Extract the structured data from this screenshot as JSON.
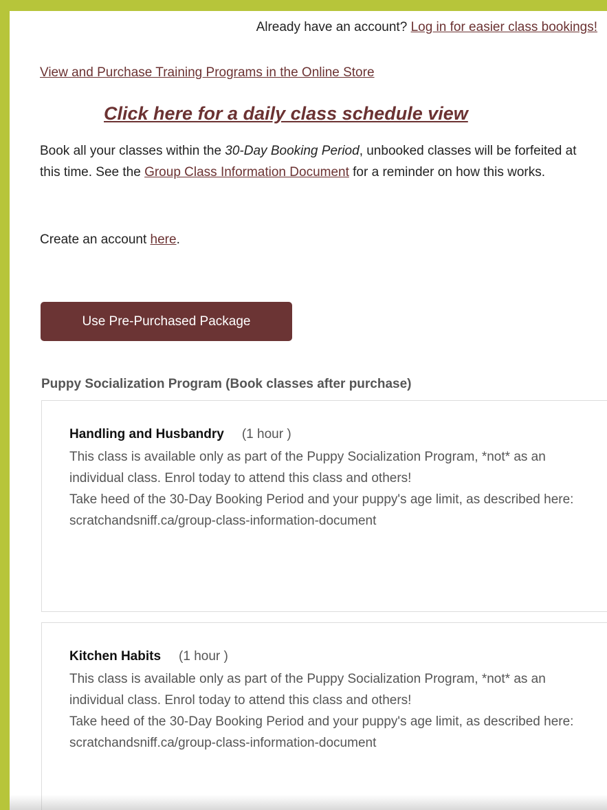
{
  "header": {
    "account_prompt": "Already have an account?",
    "login_link": "Log in for easier class bookings!"
  },
  "store_link": "View and Purchase Training Programs in the Online Store",
  "schedule_link": "Click here for a daily class schedule view",
  "intro": {
    "part1": "Book all your classes within the ",
    "booking_period": "30-Day Booking Period",
    "part2": ", unbooked classes will be forfeited at this time. See the ",
    "info_link": "Group Class Information Document",
    "part3": " for a reminder on how this works."
  },
  "create_account": {
    "prefix": "Create an account ",
    "link": "here",
    "suffix": "."
  },
  "package_button": "Use Pre-Purchased Package",
  "program": {
    "heading": "Puppy Socialization Program (Book classes after purchase)",
    "classes": [
      {
        "name": "Handling and Husbandry",
        "duration": "(1 hour )",
        "description": "This class is available only as part of the Puppy Socialization Program, *not* as an individual class. Enrol today to attend this class and others!",
        "note": "Take heed of the 30-Day Booking Period and your puppy's age limit, as described here: scratchandsniff.ca/group-class-information-document"
      },
      {
        "name": "Kitchen Habits",
        "duration": "(1 hour )",
        "description": "This class is available only as part of the Puppy Socialization Program, *not* as an individual class. Enrol today to attend this class and others!",
        "note": "Take heed of the 30-Day Booking Period and your puppy's age limit, as described here: scratchandsniff.ca/group-class-information-document"
      }
    ]
  },
  "colors": {
    "page_background": "#b7c53a",
    "accent": "#6b3434"
  }
}
